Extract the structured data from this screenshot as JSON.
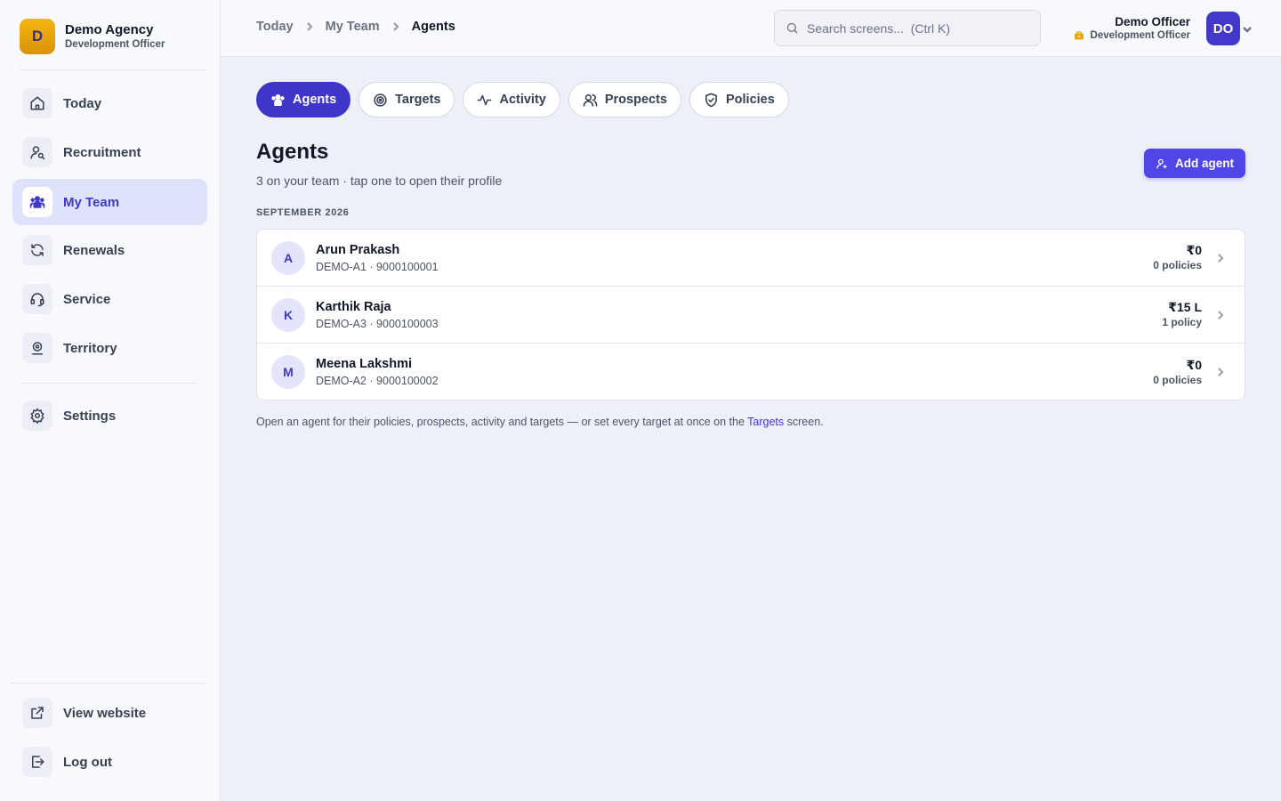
{
  "sidebar": {
    "brand": {
      "initial": "D",
      "name": "Demo Agency",
      "role": "Development Officer"
    },
    "items": [
      {
        "label": "Today",
        "icon": "home-icon"
      },
      {
        "label": "Recruitment",
        "icon": "user-search-icon"
      },
      {
        "label": "My Team",
        "icon": "team-icon",
        "active": true
      },
      {
        "label": "Renewals",
        "icon": "refresh-icon"
      },
      {
        "label": "Service",
        "icon": "headset-icon"
      },
      {
        "label": "Territory",
        "icon": "map-pin-icon"
      }
    ],
    "settings_label": "Settings",
    "view_website_label": "View website",
    "logout_label": "Log out"
  },
  "header": {
    "breadcrumb": [
      "Today",
      "My Team",
      "Agents"
    ],
    "search_placeholder": "Search screens...  (Ctrl K)",
    "user": {
      "name": "Demo Officer",
      "role": "Development Officer",
      "initials": "DO"
    }
  },
  "tabs": [
    {
      "label": "Agents",
      "icon": "team-icon",
      "active": true
    },
    {
      "label": "Targets",
      "icon": "target-icon"
    },
    {
      "label": "Activity",
      "icon": "activity-icon"
    },
    {
      "label": "Prospects",
      "icon": "users-icon"
    },
    {
      "label": "Policies",
      "icon": "shield-check-icon"
    }
  ],
  "main": {
    "title": "Agents",
    "subtitle": "3 on your team · tap one to open their profile",
    "add_button": "Add agent",
    "section": "SEPTEMBER 2026",
    "agents": [
      {
        "initial": "A",
        "name": "Arun Prakash",
        "meta": "DEMO-A1 · 9000100001",
        "amount": "₹0",
        "policies": "0 policies"
      },
      {
        "initial": "K",
        "name": "Karthik Raja",
        "meta": "DEMO-A3 · 9000100003",
        "amount": "₹15 L",
        "policies": "1 policy"
      },
      {
        "initial": "M",
        "name": "Meena Lakshmi",
        "meta": "DEMO-A2 · 9000100002",
        "amount": "₹0",
        "policies": "0 policies"
      }
    ],
    "footnote_before": "Open an agent for their policies, prospects, activity and targets — or set every target at once on the ",
    "footnote_link": "Targets",
    "footnote_after": " screen."
  },
  "colors": {
    "accent": "#3f35c9",
    "brand_logo": "#f4b512",
    "background": "#eef0f8"
  }
}
